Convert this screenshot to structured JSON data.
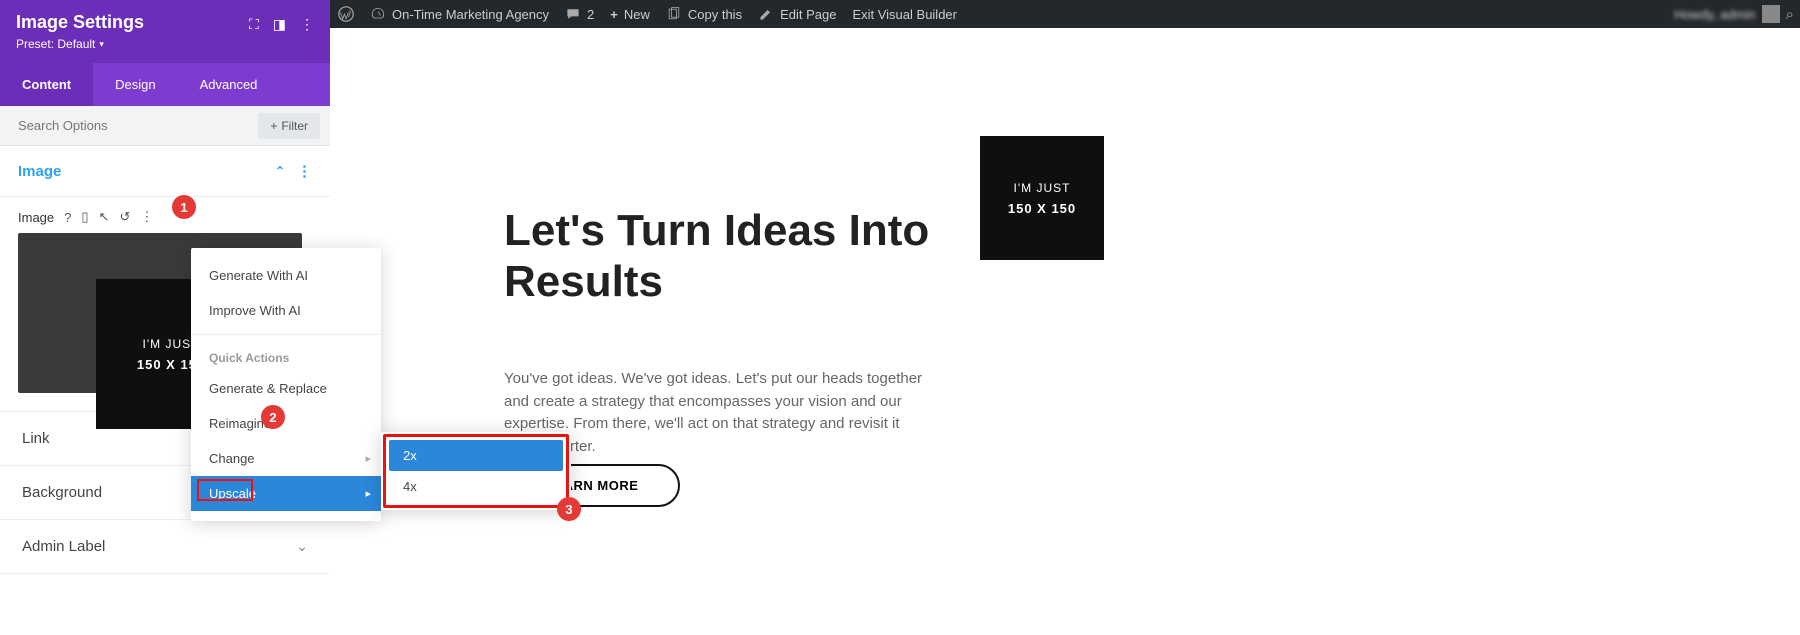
{
  "adminbar": {
    "site_name": "On-Time Marketing Agency",
    "comments": "2",
    "new_label": "New",
    "copy_label": "Copy this",
    "edit_page": "Edit Page",
    "exit_vb": "Exit Visual Builder",
    "user_greeting": "Howdy, admin"
  },
  "panel": {
    "title": "Image Settings",
    "preset_label": "Preset: Default",
    "tabs": {
      "content": "Content",
      "design": "Design",
      "advanced": "Advanced"
    },
    "search_placeholder": "Search Options",
    "filter_label": "Filter",
    "section_image": "Image",
    "field_label": "Image",
    "image_text": "I'M JUST",
    "image_dim": "150 X 150",
    "sections": {
      "link": "Link",
      "background": "Background",
      "admin_label": "Admin Label"
    }
  },
  "dropdown": {
    "generate": "Generate With AI",
    "improve": "Improve With AI",
    "quick_actions": "Quick Actions",
    "generate_replace": "Generate & Replace",
    "reimagine": "Reimagine",
    "change": "Change",
    "upscale": "Upscale",
    "options": {
      "x2": "2x",
      "x4": "4x"
    }
  },
  "badges": {
    "b1": "1",
    "b2": "2",
    "b3": "3"
  },
  "canvas": {
    "headline": "Let's Turn Ideas Into Results",
    "body": "You've got ideas. We've got ideas. Let's put our heads together and create a strategy that encompasses your vision and our expertise. From there, we'll act on that strategy and revisit it every qaurter.",
    "button": "LEARN MORE",
    "img_text": "I'M JUST",
    "img_dim": "150 X 150"
  }
}
